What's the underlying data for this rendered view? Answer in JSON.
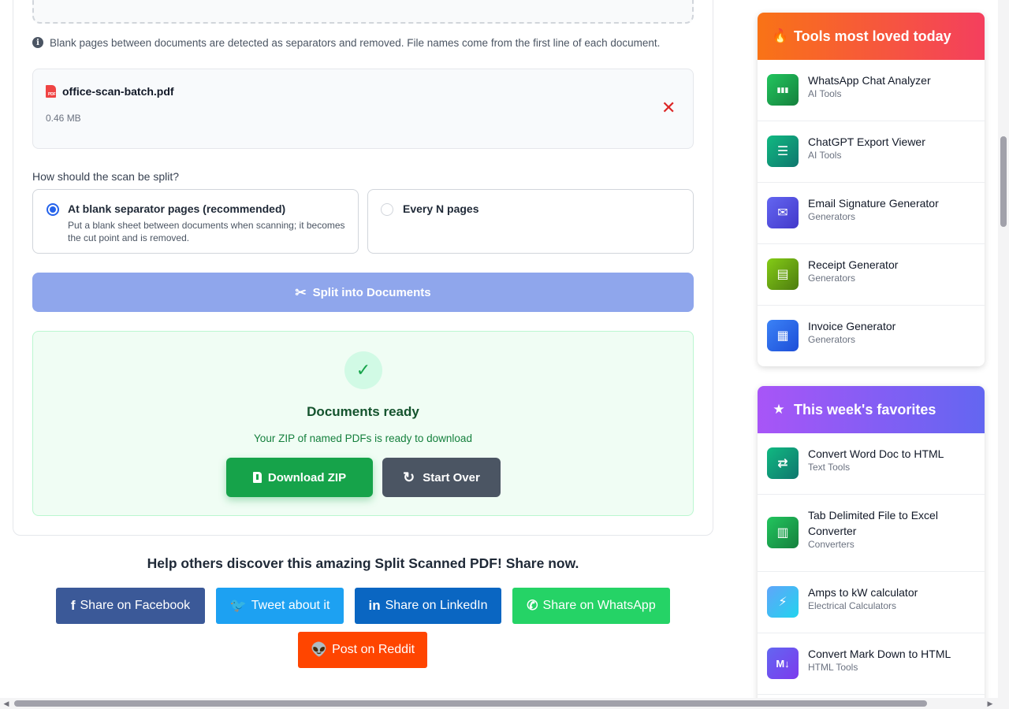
{
  "info": {
    "icon": "info-circle-icon",
    "text": "Blank pages between documents are detected as separators and removed. File names come from the first line of each document."
  },
  "file": {
    "name": "office-scan-batch.pdf",
    "size": "0.46 MB",
    "icon_tag": "PDF",
    "remove_glyph": "✕"
  },
  "split": {
    "question": "How should the scan be split?",
    "options": [
      {
        "title": "At blank separator pages (recommended)",
        "description": "Put a blank sheet between documents when scanning; it becomes the cut point and is removed.",
        "selected": true
      },
      {
        "title": "Every N pages",
        "description": "",
        "selected": false
      }
    ],
    "button_label": "Split into Documents"
  },
  "result": {
    "title": "Documents ready",
    "subtitle": "Your ZIP of named PDFs is ready to download",
    "download_label": "Download ZIP",
    "start_over_label": "Start Over"
  },
  "share": {
    "title": "Help others discover this amazing Split Scanned PDF! Share now.",
    "buttons": [
      {
        "label": "Share on Facebook",
        "glyph": "f",
        "color": "#3b5998"
      },
      {
        "label": "Tweet about it",
        "glyph": "🐦",
        "color": "#1da1f2"
      },
      {
        "label": "Share on LinkedIn",
        "glyph": "in",
        "color": "#0a66c2"
      },
      {
        "label": "Share on WhatsApp",
        "glyph": "✆",
        "color": "#25d366"
      },
      {
        "label": "Post on Reddit",
        "glyph": "👽",
        "color": "#ff4500"
      }
    ]
  },
  "sidebar": {
    "loved": {
      "title": "Tools most loved today",
      "icon": "fire-icon",
      "items": [
        {
          "name": "WhatsApp Chat Analyzer",
          "category": "AI Tools",
          "glyph": "▮▮▮"
        },
        {
          "name": "ChatGPT Export Viewer",
          "category": "AI Tools",
          "glyph": "☰"
        },
        {
          "name": "Email Signature Generator",
          "category": "Generators",
          "glyph": "✉"
        },
        {
          "name": "Receipt Generator",
          "category": "Generators",
          "glyph": "▤"
        },
        {
          "name": "Invoice Generator",
          "category": "Generators",
          "glyph": "▦"
        }
      ]
    },
    "favorites": {
      "title": "This week's favorites",
      "icon": "star-icon",
      "items": [
        {
          "name": "Convert Word Doc to HTML",
          "category": "Text Tools",
          "glyph": "⇄"
        },
        {
          "name": "Tab Delimited File to Excel Converter",
          "category": "Converters",
          "glyph": "▥"
        },
        {
          "name": "Amps to kW calculator",
          "category": "Electrical Calculators",
          "glyph": "⚡"
        },
        {
          "name": "Convert Mark Down to HTML",
          "category": "HTML Tools",
          "glyph": "M↓"
        }
      ]
    }
  },
  "colors": {
    "primary": "#2563eb",
    "success": "#16a34a",
    "danger": "#dc2626"
  }
}
